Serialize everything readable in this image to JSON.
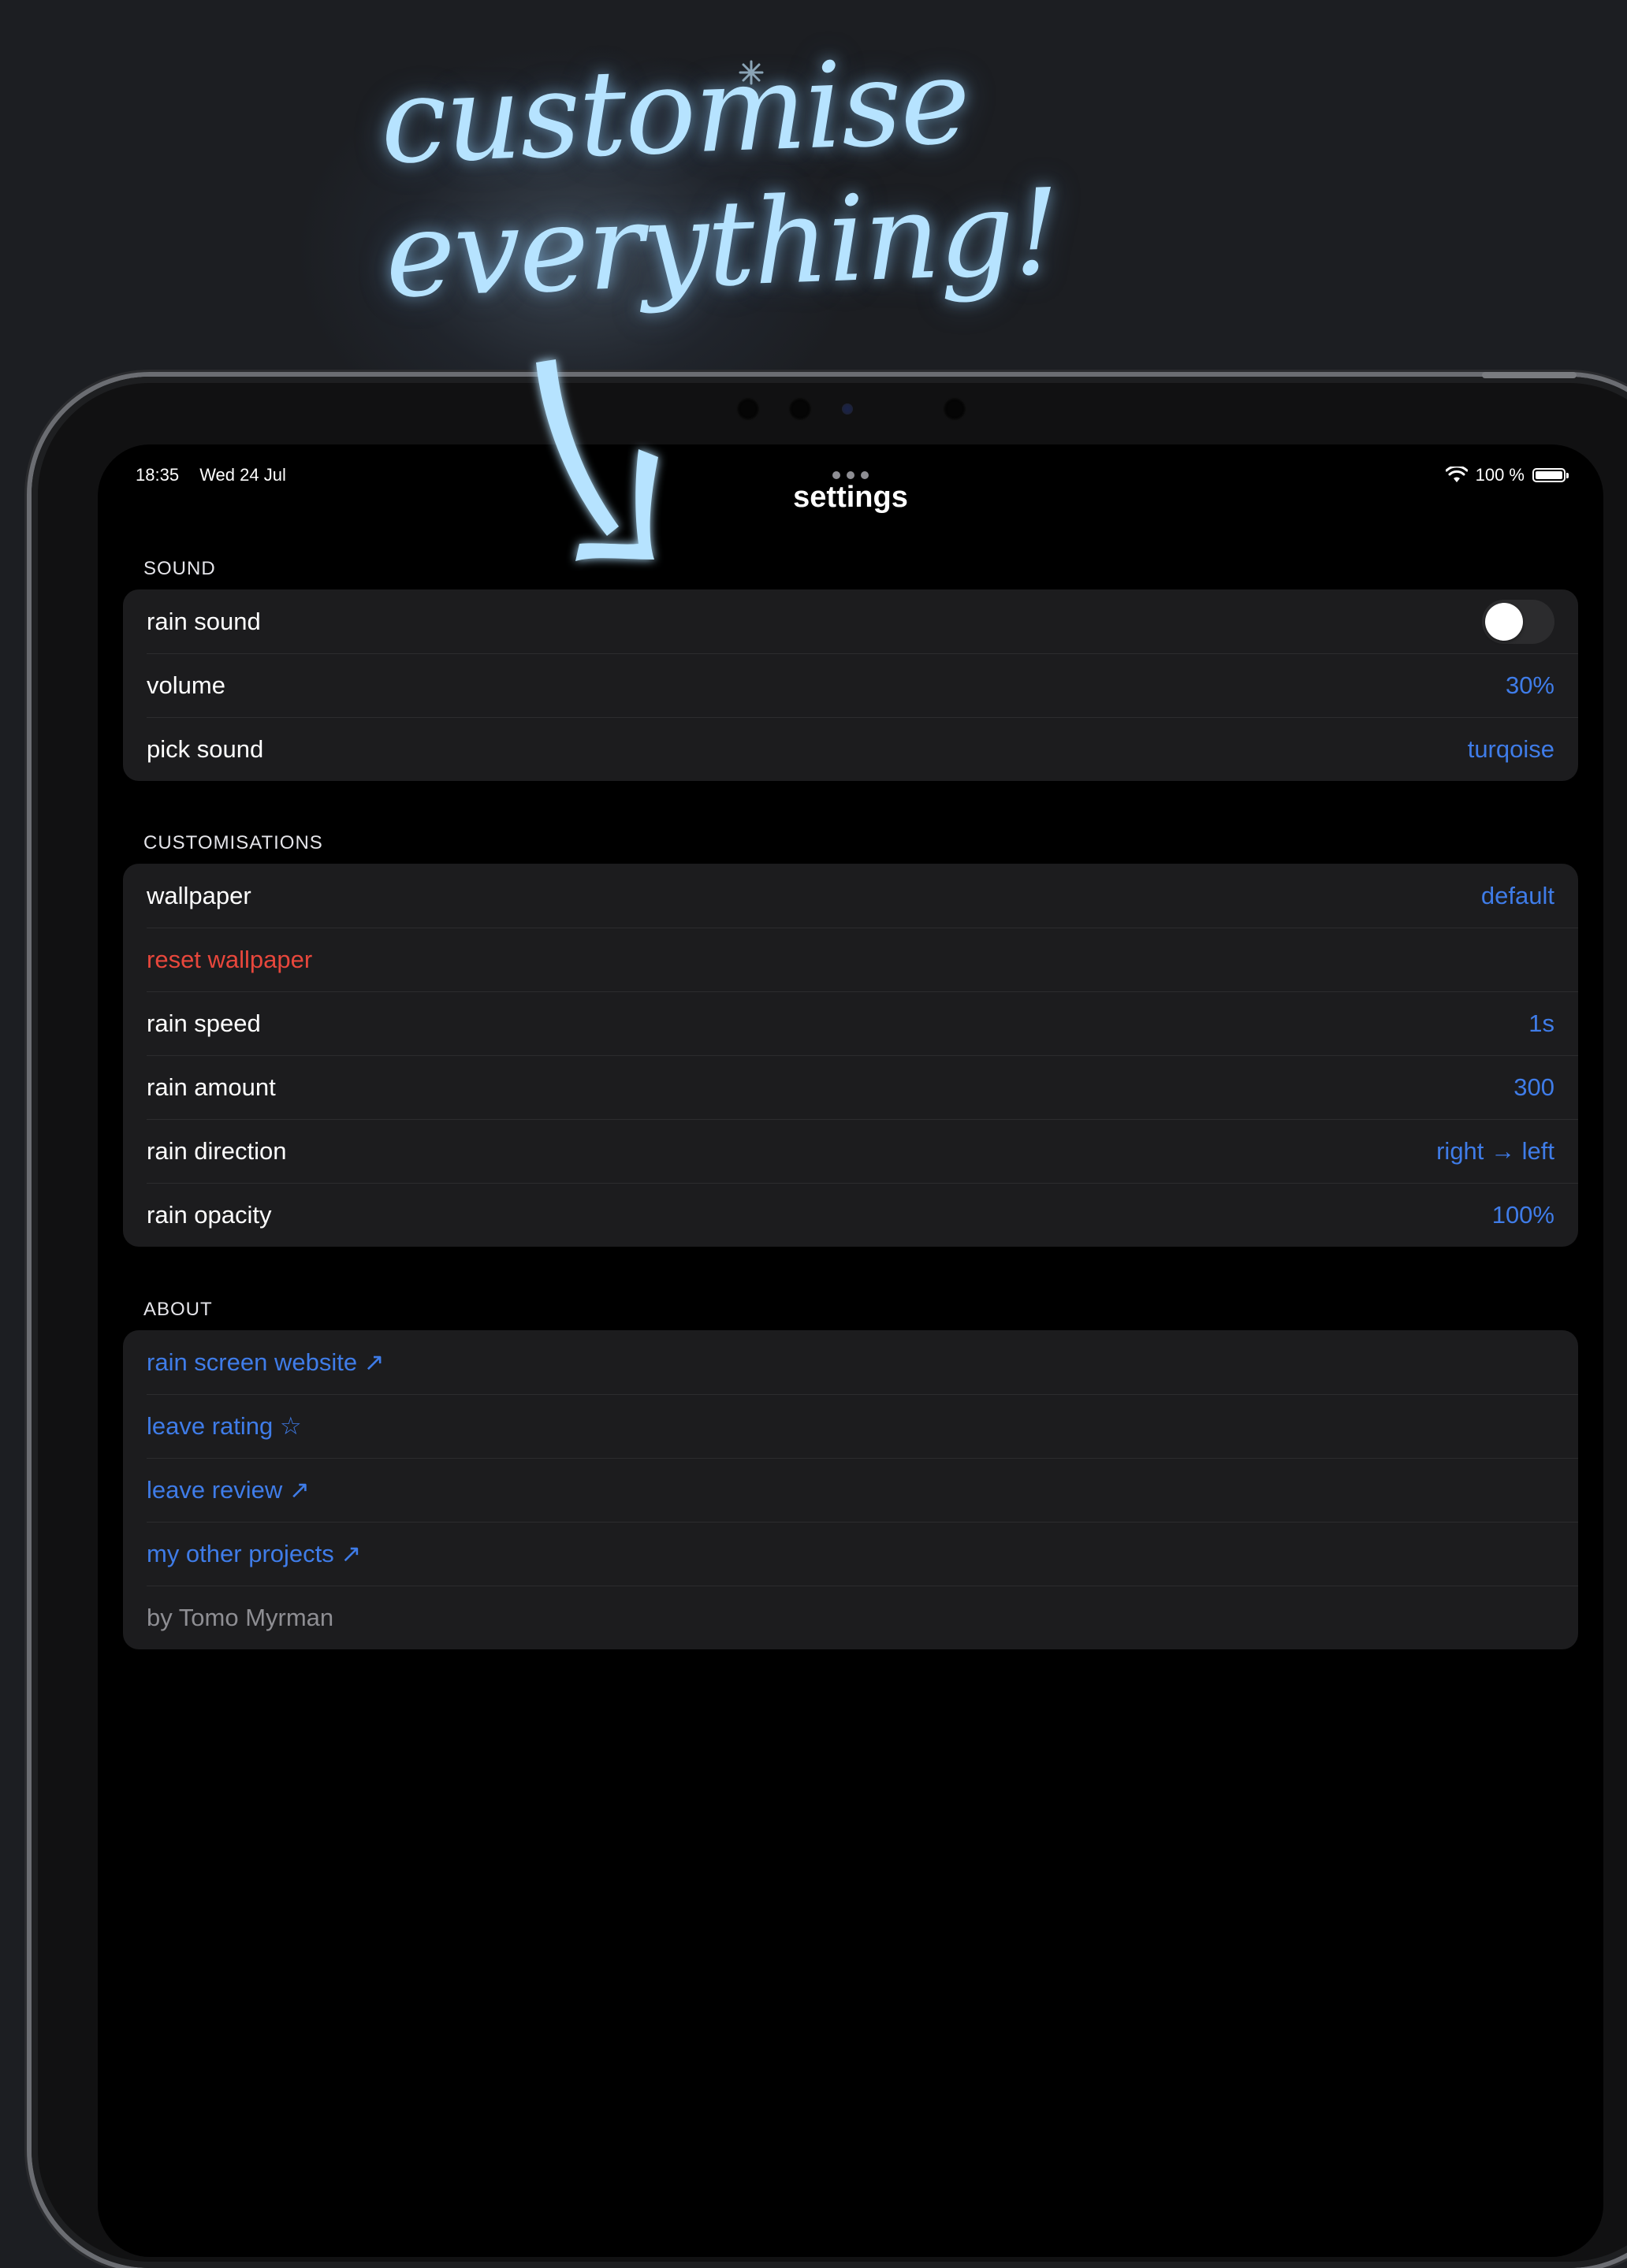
{
  "promo": {
    "headline_line1": "customise",
    "headline_line2": "everything!"
  },
  "status_bar": {
    "time": "18:35",
    "date": "Wed 24 Jul",
    "battery": "100 %"
  },
  "screen": {
    "title": "settings"
  },
  "sections": {
    "sound": {
      "header": "SOUND",
      "rain_sound_label": "rain sound",
      "rain_sound_enabled": false,
      "volume_label": "volume",
      "volume_value": "30%",
      "pick_sound_label": "pick sound",
      "pick_sound_value": "turqoise"
    },
    "customisations": {
      "header": "CUSTOMISATIONS",
      "wallpaper_label": "wallpaper",
      "wallpaper_value": "default",
      "reset_wallpaper_label": "reset wallpaper",
      "rain_speed_label": "rain speed",
      "rain_speed_value": "1s",
      "rain_amount_label": "rain amount",
      "rain_amount_value": "300",
      "rain_direction_label": "rain direction",
      "rain_direction_value": "right → left",
      "rain_opacity_label": "rain opacity",
      "rain_opacity_value": "100%"
    },
    "about": {
      "header": "ABOUT",
      "website_label": "rain screen website ↗",
      "rating_label": "leave rating ☆",
      "review_label": "leave review ↗",
      "projects_label": "my other projects ↗",
      "credit": "by Tomo Myrman"
    }
  },
  "colors": {
    "accent_blue": "#3f7ce8",
    "destructive_red": "#e8473c",
    "headline_glow": "#b6e3ff",
    "background": "#1c1e22"
  }
}
